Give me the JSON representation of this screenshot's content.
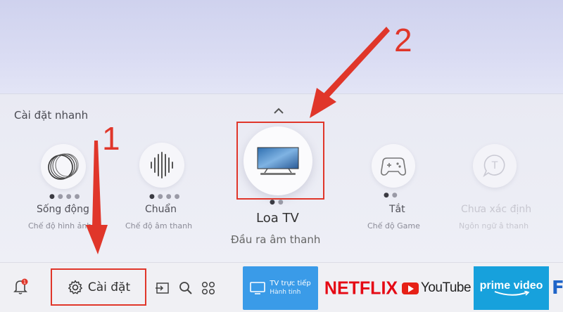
{
  "quick_settings": {
    "title": "Cài đặt nhanh",
    "tiles": [
      {
        "label": "Sống động",
        "sub": "Chế độ hình ảnh",
        "icon": "picture-mode-icon"
      },
      {
        "label": "Chuẩn",
        "sub": "Chế độ âm thanh",
        "icon": "sound-mode-icon"
      },
      {
        "label": "Loa TV",
        "sub": "Đầu ra âm thanh",
        "icon": "tv-speaker-icon"
      },
      {
        "label": "Tắt",
        "sub": "Chế độ Game",
        "icon": "gamepad-icon"
      },
      {
        "label": "Chưa xác định",
        "sub": "Ngôn ngữ â thanh",
        "icon": "language-icon"
      }
    ]
  },
  "annotations": {
    "one": "1",
    "two": "2"
  },
  "bottom_bar": {
    "settings_label": "Cài đặt",
    "notification_badge": "1",
    "apps": {
      "tv_live_title": "TV trực tiếp",
      "tv_live_sub": "Hành tinh",
      "netflix": "NETFLIX",
      "youtube": "YouTube",
      "prime": "prime video",
      "partial": "F"
    }
  },
  "colors": {
    "annotation_red": "#e0362a",
    "netflix_red": "#e50914",
    "prime_blue": "#17a1dc",
    "tv_live_blue": "#3a9be8"
  }
}
